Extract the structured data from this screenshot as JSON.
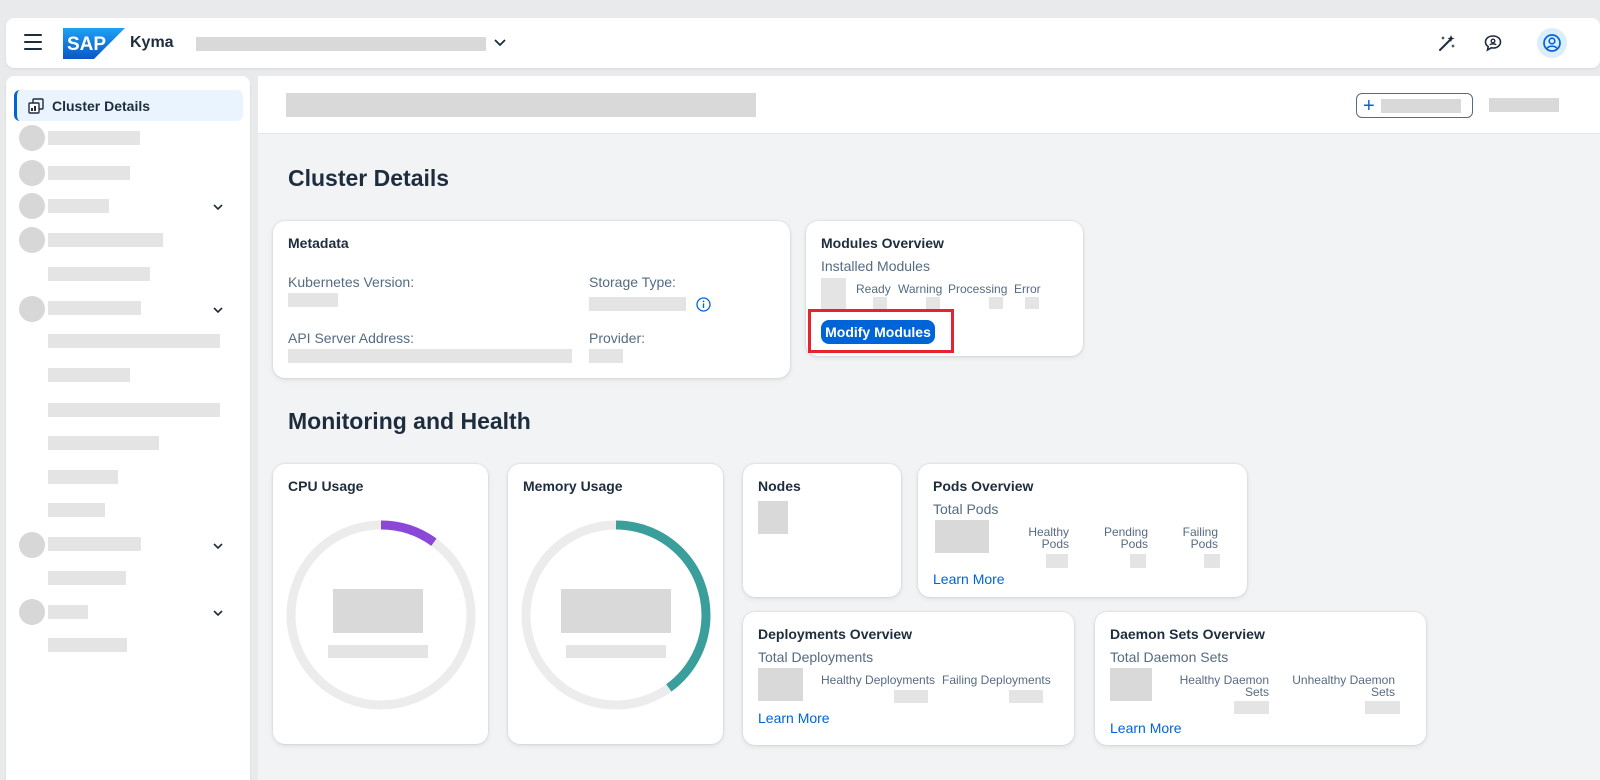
{
  "shell": {
    "app_name": "Kyma",
    "logo_text": "SAP"
  },
  "sidebar": {
    "selected_item": "Cluster Details"
  },
  "main": {
    "cluster_details_heading": "Cluster Details",
    "monitoring_heading": "Monitoring and Health"
  },
  "metadata_card": {
    "title": "Metadata",
    "kubernetes_version_label": "Kubernetes Version:",
    "storage_type_label": "Storage Type:",
    "api_server_label": "API Server Address:",
    "provider_label": "Provider:"
  },
  "modules_card": {
    "title": "Modules Overview",
    "installed_label": "Installed Modules",
    "ready": "Ready",
    "warning": "Warning",
    "processing": "Processing",
    "error": "Error",
    "modify_button": "Modify Modules"
  },
  "cpu_card": {
    "title": "CPU Usage",
    "usage_fraction": 0.1
  },
  "memory_card": {
    "title": "Memory Usage",
    "usage_fraction": 0.4
  },
  "nodes_card": {
    "title": "Nodes"
  },
  "pods_card": {
    "title": "Pods Overview",
    "total_label": "Total Pods",
    "healthy_l1": "Healthy",
    "healthy_l2": "Pods",
    "pending_l1": "Pending",
    "pending_l2": "Pods",
    "failing_l1": "Failing",
    "failing_l2": "Pods",
    "learn_more": "Learn More"
  },
  "deployments_card": {
    "title": "Deployments Overview",
    "total_label": "Total Deployments",
    "healthy": "Healthy Deployments",
    "failing": "Failing Deployments",
    "learn_more": "Learn More"
  },
  "daemonsets_card": {
    "title": "Daemon Sets Overview",
    "total_label": "Total Daemon Sets",
    "healthy_l1": "Healthy Daemon",
    "healthy_l2": "Sets",
    "unhealthy_l1": "Unhealthy Daemon",
    "unhealthy_l2": "Sets",
    "learn_more": "Learn More"
  },
  "colors": {
    "accent": "#0064d9",
    "cpu_ring": "#8b47d7",
    "memory_ring": "#3a9e9a",
    "ring_track": "#ececec",
    "highlight": "#e5242b"
  }
}
